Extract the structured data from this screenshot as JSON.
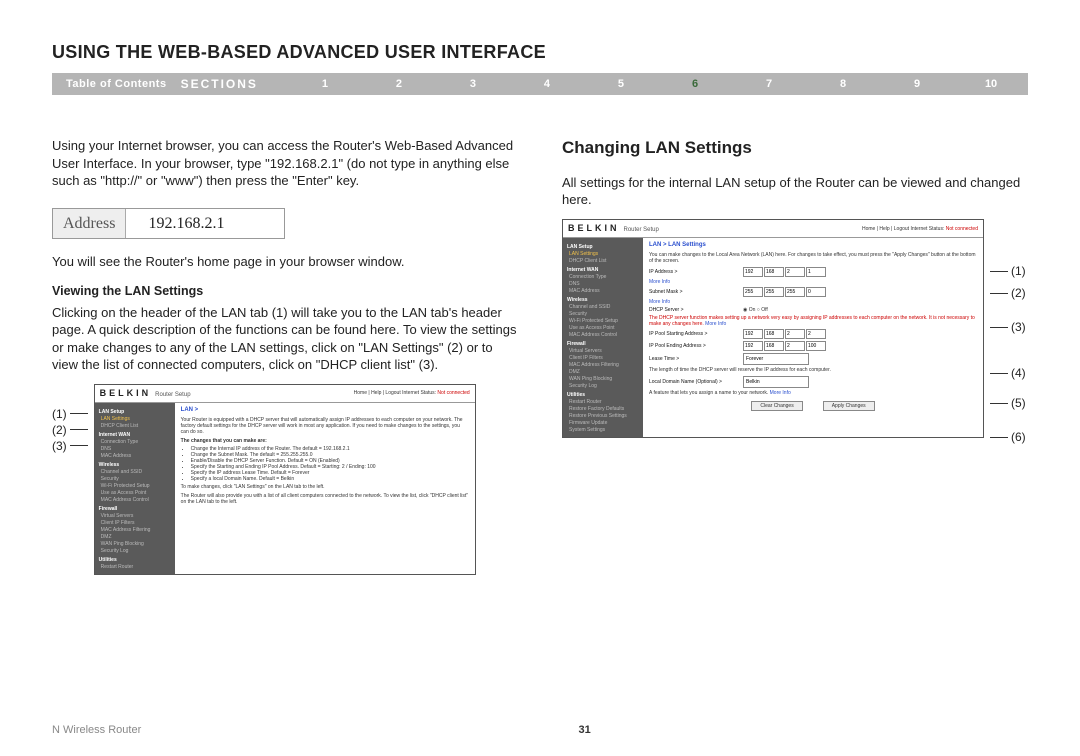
{
  "page_title": "USING THE WEB-BASED ADVANCED USER INTERFACE",
  "nav": {
    "toc": "Table of Contents",
    "sections_label": "SECTIONS",
    "items": [
      "1",
      "2",
      "3",
      "4",
      "5",
      "6",
      "7",
      "8",
      "9",
      "10"
    ],
    "current": "6"
  },
  "left": {
    "p1": "Using your Internet browser, you can access the Router's Web-Based Advanced User Interface. In your browser, type \"192.168.2.1\" (do not type in anything else such as \"http://\" or \"www\") then press the \"Enter\" key.",
    "address_label": "Address",
    "address_value": "192.168.2.1",
    "p2": "You will see the Router's home page in your browser window.",
    "sub": "Viewing the LAN Settings",
    "p3": "Clicking on the header of the LAN tab (1) will take you to the LAN tab's header page. A quick description of the functions can be found here. To view the settings or make changes to any of the LAN settings, click on \"LAN Settings\" (2) or to view the list of connected computers, click on \"DHCP client list\" (3).",
    "callouts": [
      "(1)",
      "(2)",
      "(3)"
    ]
  },
  "right": {
    "heading": "Changing LAN Settings",
    "p1": "All settings for the internal LAN setup of the Router can be viewed and changed here.",
    "callouts": [
      "(1)",
      "(2)",
      "(3)",
      "(4)",
      "(5)",
      "(6)"
    ]
  },
  "shot_common": {
    "brand": "BELKIN",
    "brand_sub": "Router Setup",
    "hdr_links": "Home | Help | Logout   Internet Status:",
    "hdr_status": "Not connected"
  },
  "shot1": {
    "sidebar": {
      "groups": [
        {
          "title": "LAN Setup",
          "items": [
            "LAN Settings",
            "DHCP Client List"
          ]
        },
        {
          "title": "Internet WAN",
          "items": [
            "Connection Type",
            "DNS",
            "MAC Address"
          ]
        },
        {
          "title": "Wireless",
          "items": [
            "Channel and SSID",
            "Security",
            "Wi-Fi Protected Setup",
            "Use as Access Point",
            "MAC Address Control"
          ]
        },
        {
          "title": "Firewall",
          "items": [
            "Virtual Servers",
            "Client IP Filters",
            "MAC Address Filtering",
            "DMZ",
            "WAN Ping Blocking",
            "Security Log"
          ]
        },
        {
          "title": "Utilities",
          "items": [
            "Restart Router"
          ]
        }
      ]
    },
    "crumb": "LAN >",
    "desc": "Your Router is equipped with a DHCP server that will automatically assign IP addresses to each computer on your network. The factory default settings for the DHCP server will work in most any application. If you need to make changes to the settings, you can do so.",
    "sub": "The changes that you can make are:",
    "bullets": [
      "Change the Internal IP address of the Router. The default = 192.168.2.1",
      "Change the Subnet Mask. The default = 255.255.255.0",
      "Enable/Disable the DHCP Server Function. Default = ON (Enabled)",
      "Specify the Starting and Ending IP Pool Address. Default = Starting: 2 / Ending: 100",
      "Specify the IP address Lease Time. Default = Forever",
      "Specify a local Domain Name. Default = Belkin"
    ],
    "note1": "To make changes, click \"LAN Settings\" on the LAN tab to the left.",
    "note2": "The Router will also provide you with a list of all client computers connected to the network. To view the list, click \"DHCP client list\" on the LAN tab to the left."
  },
  "shot2": {
    "crumb": "LAN > LAN Settings",
    "desc": "You can make changes to the Local Area Network (LAN) here. For changes to take effect, you must press the \"Apply Changes\" button at the bottom of the screen.",
    "rows": {
      "ip_label": "IP Address >",
      "ip": [
        "192",
        "168",
        "2",
        "1"
      ],
      "subnet_label": "Subnet Mask >",
      "subnet": [
        "255",
        "255",
        "255",
        "0"
      ],
      "dhcp_label": "DHCP Server >",
      "dhcp_on": "On",
      "dhcp_off": "Off",
      "dhcp_desc": "The DHCP server function makes setting up a network very easy by assigning IP addresses to each computer on the network. It is not necessary to make any changes here.",
      "pool_start_label": "IP Pool Starting Address >",
      "pool_start": [
        "192",
        "168",
        "2",
        "2"
      ],
      "pool_end_label": "IP Pool Ending Address >",
      "pool_end": [
        "192",
        "168",
        "2",
        "100"
      ],
      "lease_label": "Lease Time >",
      "lease_value": "Forever",
      "lease_desc": "The length of time the DHCP server will reserve the IP address for each computer.",
      "domain_label": "Local Domain Name (Optional) >",
      "domain_value": "Belkin",
      "domain_desc": "A feature that lets you assign a name to your network."
    },
    "more": "More Info",
    "btn_clear": "Clear Changes",
    "btn_apply": "Apply Changes",
    "sidebar_extra": [
      "Restore Factory Defaults",
      "Restore Previous Settings",
      "Firmware Update",
      "System Settings"
    ]
  },
  "footer": {
    "product": "N Wireless Router",
    "page": "31"
  }
}
